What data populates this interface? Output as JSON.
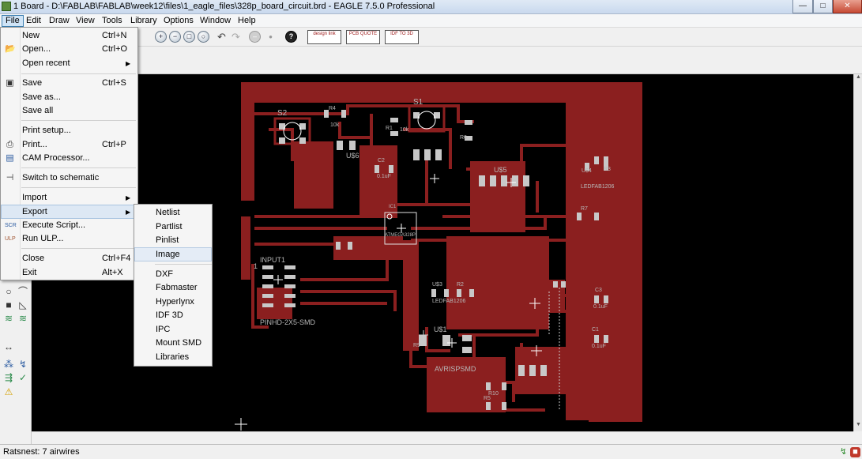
{
  "window": {
    "title": "1 Board - D:\\FABLAB\\FABLAB\\week12\\files\\1_eagle_files\\328p_board_circuit.brd - EAGLE 7.5.0 Professional",
    "minimize_glyph": "—",
    "maximize_glyph": "□",
    "close_glyph": "✕"
  },
  "menubar": {
    "items": [
      "File",
      "Edit",
      "Draw",
      "View",
      "Tools",
      "Library",
      "Options",
      "Window",
      "Help"
    ]
  },
  "toolbar": {
    "zoom_icons": [
      "zoom-in-icon",
      "zoom-out-icon",
      "zoom-select-icon",
      "zoom-fit-icon"
    ],
    "undo_glyph": "↶",
    "redo_glyph": "↷",
    "stop_glyph": "–",
    "go_glyph": "•",
    "help_glyph": "?",
    "ext_buttons": [
      {
        "name": "design-link-button",
        "label": "design link"
      },
      {
        "name": "pcb-quote-button",
        "label": "PCB QUOTE"
      },
      {
        "name": "idf-to-3d-button",
        "label": "IDF TO 3D"
      }
    ]
  },
  "file_menu": {
    "items": [
      {
        "label": "New",
        "shortcut": "Ctrl+N",
        "icon": "",
        "submenu": false
      },
      {
        "label": "Open...",
        "shortcut": "Ctrl+O",
        "icon": "open-folder-icon",
        "submenu": false
      },
      {
        "label": "Open recent",
        "shortcut": "",
        "icon": "",
        "submenu": true
      },
      {
        "label": "Save",
        "shortcut": "Ctrl+S",
        "icon": "save-disk-icon",
        "submenu": false
      },
      {
        "label": "Save as...",
        "shortcut": "",
        "icon": "",
        "submenu": false
      },
      {
        "label": "Save all",
        "shortcut": "",
        "icon": "",
        "submenu": false
      },
      {
        "label": "Print setup...",
        "shortcut": "",
        "icon": "",
        "submenu": false
      },
      {
        "label": "Print...",
        "shortcut": "Ctrl+P",
        "icon": "printer-icon",
        "submenu": false
      },
      {
        "label": "CAM Processor...",
        "shortcut": "",
        "icon": "cam-processor-icon",
        "submenu": false
      },
      {
        "label": "Switch to schematic",
        "shortcut": "",
        "icon": "schematic-icon",
        "submenu": false
      },
      {
        "label": "Import",
        "shortcut": "",
        "icon": "",
        "submenu": true
      },
      {
        "label": "Export",
        "shortcut": "",
        "icon": "",
        "submenu": true
      },
      {
        "label": "Execute Script...",
        "shortcut": "",
        "icon": "script-icon",
        "submenu": false
      },
      {
        "label": "Run ULP...",
        "shortcut": "",
        "icon": "ulp-icon",
        "submenu": false
      },
      {
        "label": "Close",
        "shortcut": "Ctrl+F4",
        "icon": "",
        "submenu": false
      },
      {
        "label": "Exit",
        "shortcut": "Alt+X",
        "icon": "",
        "submenu": false
      }
    ],
    "submenu_arrow": "▶"
  },
  "export_menu": {
    "items": [
      "Netlist",
      "Partlist",
      "Pinlist",
      "Image",
      "DXF",
      "Fabmaster",
      "Hyperlynx",
      "IDF 3D",
      "IPC",
      "Mount SMD",
      "Libraries"
    ]
  },
  "board": {
    "copper_color": "#8b1f1f",
    "labels": [
      {
        "text": "S2"
      },
      {
        "text": "R4"
      },
      {
        "text": "10k"
      },
      {
        "text": "R1"
      },
      {
        "text": "10k"
      },
      {
        "text": "S1"
      },
      {
        "text": "R6"
      },
      {
        "text": "U$6"
      },
      {
        "text": "C2"
      },
      {
        "text": "0.1uF"
      },
      {
        "text": "U$5"
      },
      {
        "text": "U$4"
      },
      {
        "text": "LEDFAB1206"
      },
      {
        "text": "R3"
      },
      {
        "text": "R7"
      },
      {
        "text": "IC1"
      },
      {
        "text": "ATMEGA328P"
      },
      {
        "text": "INPUT1"
      },
      {
        "text": "1"
      },
      {
        "text": "PINHD-2X5-SMD"
      },
      {
        "text": "U$3"
      },
      {
        "text": "R2"
      },
      {
        "text": "LEDFAB1206"
      },
      {
        "text": "C3"
      },
      {
        "text": "0.1uF"
      },
      {
        "text": "U$1"
      },
      {
        "text": "R9"
      },
      {
        "text": "AVRISPSMD"
      },
      {
        "text": "C1"
      },
      {
        "text": "0.1uF"
      },
      {
        "text": "R10"
      },
      {
        "text": "R5"
      }
    ]
  },
  "statusbar": {
    "text": "Ratsnest: 7 airwires",
    "icons": [
      "ok-icon",
      "stop-sign-icon"
    ]
  },
  "leftbar": {
    "tools": [
      "circle-tool-icon",
      "arc-tool-icon",
      "rect-tool-icon",
      "polygon-tool-icon",
      "layer-stack-icon",
      "layers-alt-icon",
      "dimension-icon",
      "ratsnest-icon",
      "autorouter-icon",
      "route-icon",
      "drc-icon",
      "errors-icon"
    ]
  }
}
